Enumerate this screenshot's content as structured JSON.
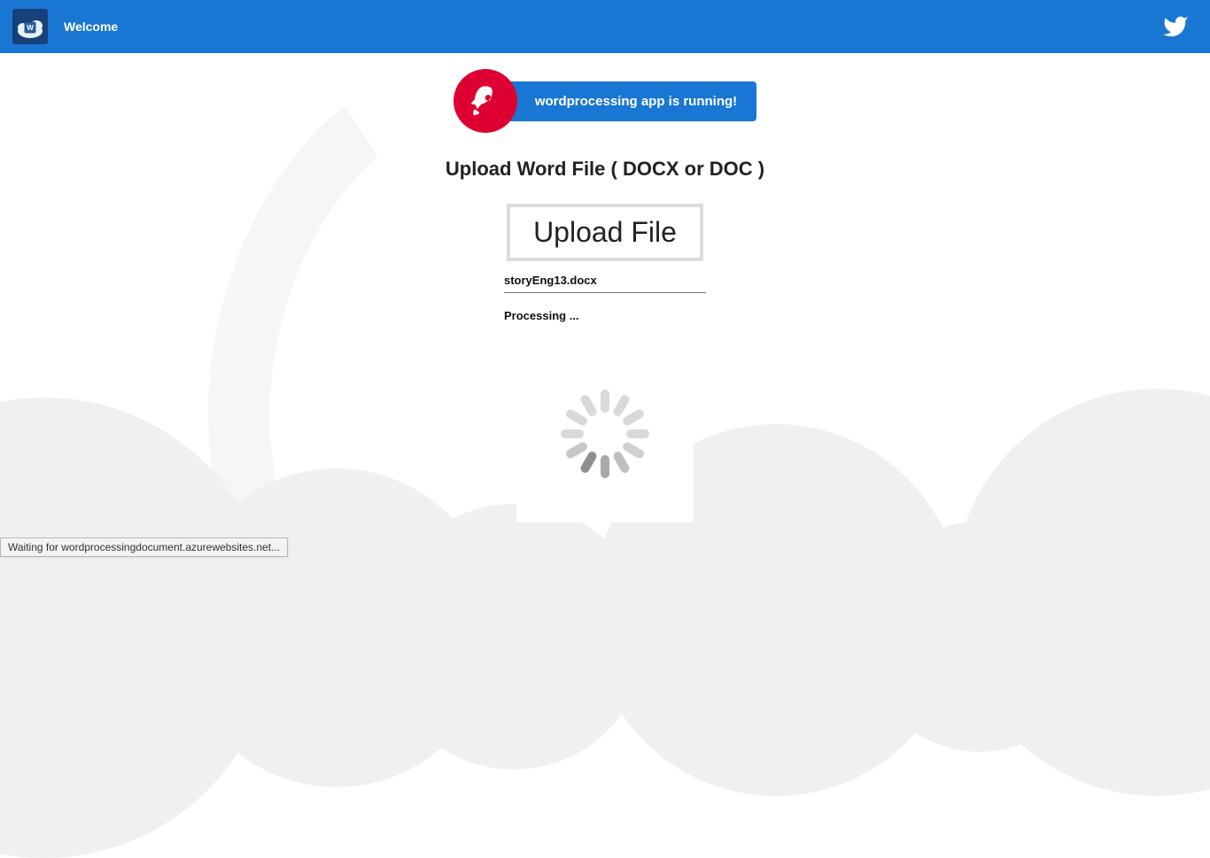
{
  "topbar": {
    "welcome": "Welcome"
  },
  "banner": {
    "text": "wordprocessing app is running!"
  },
  "heading": "Upload Word File ( DOCX or DOC )",
  "upload_button": "Upload File",
  "filename": "storyEng13.docx",
  "processing": "Processing ...",
  "status_bar": "Waiting for wordprocessingdocument.azurewebsites.net..."
}
